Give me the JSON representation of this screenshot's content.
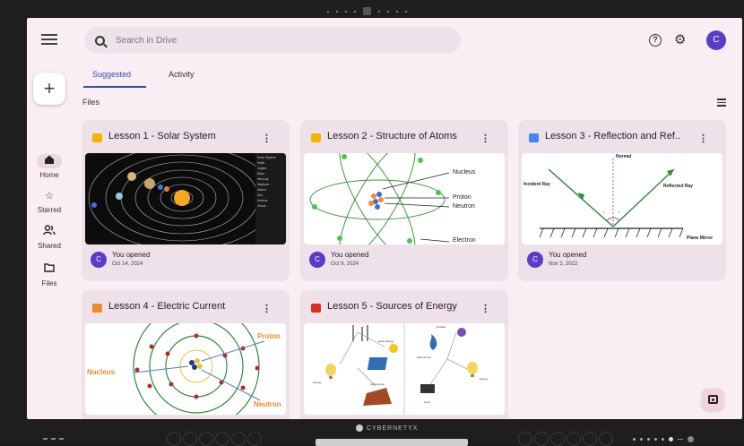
{
  "search": {
    "placeholder": "Search in Drive"
  },
  "header": {
    "avatar_letter": "C"
  },
  "new_button": {
    "label": "+"
  },
  "rail": {
    "items": [
      {
        "label": "Home",
        "icon": "home-icon"
      },
      {
        "label": "Starred",
        "icon": "star-icon"
      },
      {
        "label": "Shared",
        "icon": "shared-icon"
      },
      {
        "label": "Files",
        "icon": "folder-icon"
      }
    ]
  },
  "tabs": [
    {
      "label": "Suggested",
      "active": true
    },
    {
      "label": "Activity",
      "active": false
    }
  ],
  "section": {
    "files_label": "Files"
  },
  "cards": [
    {
      "title": "Lesson 1 - Solar System",
      "type": "slides",
      "icon_color": "#f4b400",
      "opened": "You opened",
      "date": "Oct 14, 2024",
      "avatar": "C"
    },
    {
      "title": "Lesson 2 - Structure of Atoms",
      "type": "slides",
      "icon_color": "#f4b400",
      "opened": "You opened",
      "date": "Oct 9, 2024",
      "avatar": "C"
    },
    {
      "title": "Lesson 3 - Reflection and Ref..",
      "type": "docs",
      "icon_color": "#4285f4",
      "opened": "You opened",
      "date": "Nov 2, 2022",
      "avatar": "C"
    },
    {
      "title": "Lesson 4 - Electric Current",
      "type": "office",
      "icon_color": "#f08a24",
      "opened": "",
      "date": "",
      "avatar": ""
    },
    {
      "title": "Lesson 5 - Sources of Energy",
      "type": "pdf",
      "icon_color": "#d93025",
      "opened": "",
      "date": "",
      "avatar": ""
    }
  ],
  "thumbs": {
    "solar": {
      "planets": [
        "Solar System",
        "Earth",
        "Jupiter",
        "Mars",
        "Mercury",
        "Neptune",
        "Saturn",
        "Sun",
        "Uranus",
        "Venus"
      ]
    },
    "atom": {
      "labels": [
        "Nucleus",
        "Proton",
        "Neutron",
        "Electron"
      ]
    },
    "reflection": {
      "labels": [
        "Normal",
        "Incident Ray",
        "Reflected Ray",
        "Plane Mirror",
        "i",
        "r"
      ]
    },
    "current": {
      "labels": [
        "Proton",
        "Nucleus",
        "Neutron"
      ]
    },
    "energy": {
      "labels": [
        "Solar Energy",
        "Nuclear",
        "Natural Gas",
        "Hydropower",
        "Coal",
        "Energy",
        "Energy"
      ]
    }
  },
  "device": {
    "brand": "CYBERNETYX"
  },
  "colors": {
    "accent": "#3b4aa8",
    "avatar": "#5a3cc8",
    "surface": "#f9eef3",
    "card": "#efe1ea"
  }
}
